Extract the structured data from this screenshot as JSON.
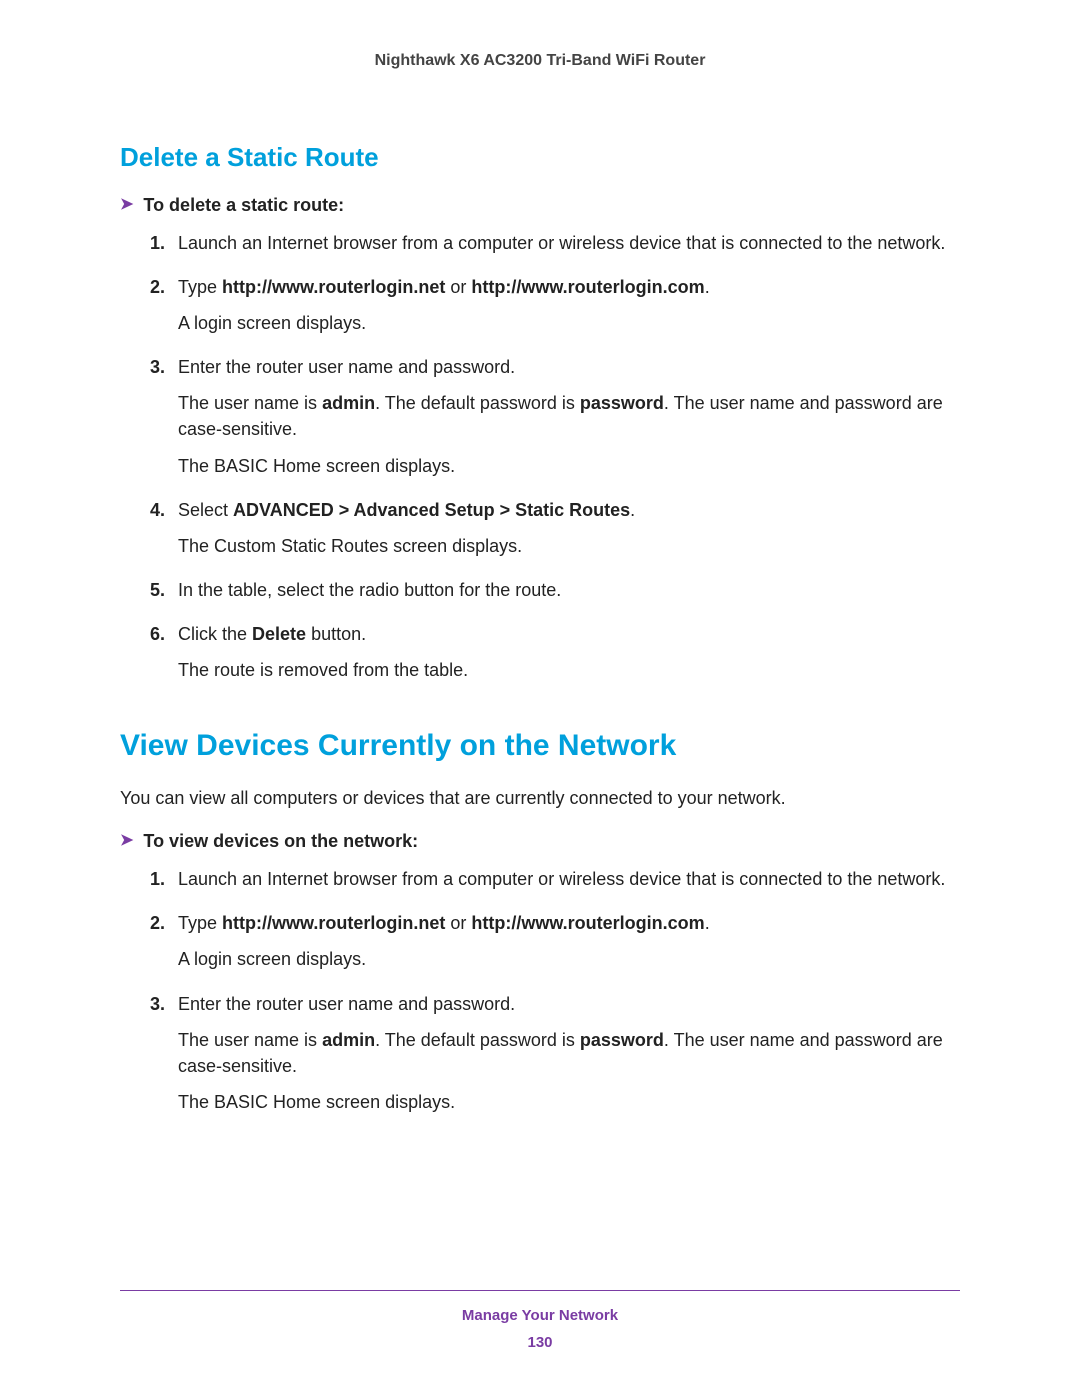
{
  "header": {
    "title": "Nighthawk X6 AC3200 Tri-Band WiFi Router"
  },
  "section1": {
    "heading": "Delete a Static Route",
    "procLabel": "To delete a static route:",
    "steps": {
      "s1": {
        "num": "1.",
        "p1": "Launch an Internet browser from a computer or wireless device that is connected to the network."
      },
      "s2": {
        "num": "2.",
        "p1a": "Type ",
        "p1b": "http://www.routerlogin.net",
        "p1c": " or ",
        "p1d": "http://www.routerlogin.com",
        "p1e": ".",
        "p2": "A login screen displays."
      },
      "s3": {
        "num": "3.",
        "p1": "Enter the router user name and password.",
        "p2a": "The user name is ",
        "p2b": "admin",
        "p2c": ". The default password is ",
        "p2d": "password",
        "p2e": ". The user name and password are case-sensitive.",
        "p3": "The BASIC Home screen displays."
      },
      "s4": {
        "num": "4.",
        "p1a": "Select ",
        "p1b": "ADVANCED > Advanced Setup > Static Routes",
        "p1c": ".",
        "p2": "The Custom Static Routes screen displays."
      },
      "s5": {
        "num": "5.",
        "p1": "In the table, select the radio button for the route."
      },
      "s6": {
        "num": "6.",
        "p1a": "Click the ",
        "p1b": "Delete",
        "p1c": " button.",
        "p2": "The route is removed from the table."
      }
    }
  },
  "section2": {
    "heading": "View Devices Currently on the Network",
    "intro": "You can view all computers or devices that are currently connected to your network.",
    "procLabel": "To view devices on the network:",
    "steps": {
      "s1": {
        "num": "1.",
        "p1": "Launch an Internet browser from a computer or wireless device that is connected to the network."
      },
      "s2": {
        "num": "2.",
        "p1a": "Type ",
        "p1b": "http://www.routerlogin.net",
        "p1c": " or ",
        "p1d": "http://www.routerlogin.com",
        "p1e": ".",
        "p2": "A login screen displays."
      },
      "s3": {
        "num": "3.",
        "p1": "Enter the router user name and password.",
        "p2a": "The user name is ",
        "p2b": "admin",
        "p2c": ". The default password is ",
        "p2d": "password",
        "p2e": ". The user name and password are case-sensitive.",
        "p3": "The BASIC Home screen displays."
      }
    }
  },
  "footer": {
    "title": "Manage Your Network",
    "page": "130"
  }
}
